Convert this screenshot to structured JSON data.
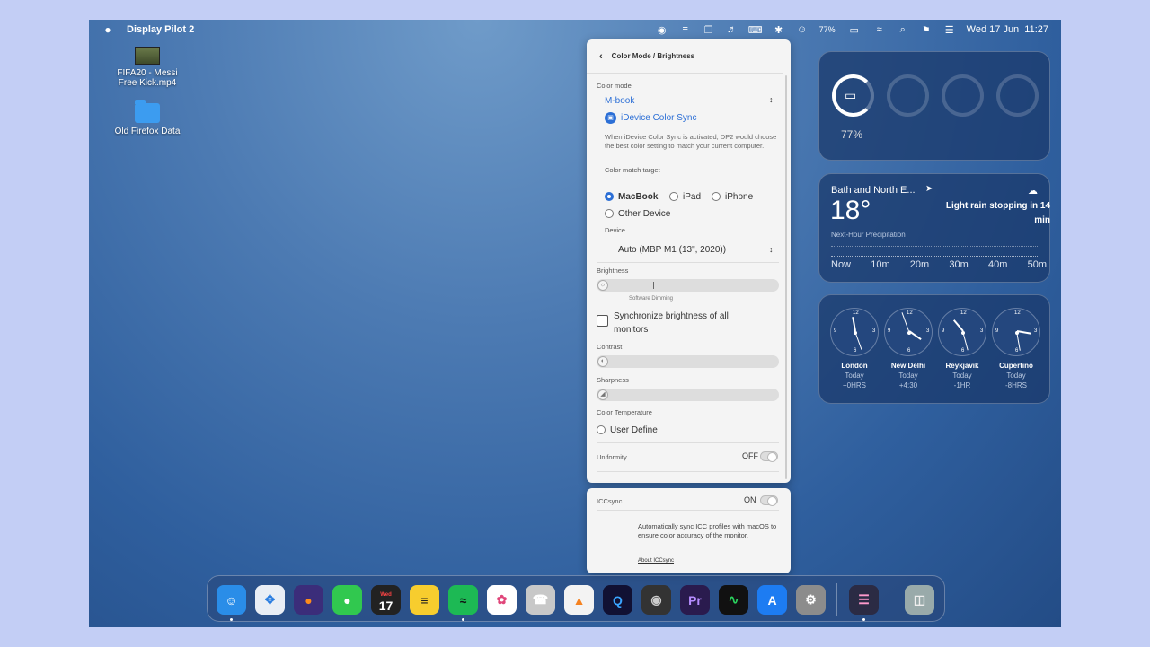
{
  "menubar": {
    "app_name": "Display Pilot 2",
    "battery": "77%",
    "datetime": "Wed 17 Jun  11:27",
    "icons": [
      "display-pilot-icon",
      "menu-extra-icon",
      "window-icon",
      "volume-icon",
      "keyboard-icon",
      "bluetooth-icon",
      "user-icon",
      "battery-icon",
      "wifi-icon",
      "search-icon",
      "flag-icon",
      "control-center-icon"
    ]
  },
  "desktop": {
    "items": [
      {
        "label": "FIFA20 - Messi Free Kick.mp4"
      },
      {
        "label": "Old Firefox Data"
      }
    ]
  },
  "panel": {
    "title": "Color Mode / Brightness",
    "color_mode_label": "Color mode",
    "color_mode_value": "M-book",
    "idevice_sync_label": "iDevice Color Sync",
    "idevice_sync_desc": "When iDevice Color Sync is activated, DP2 would choose the best color setting to match your current computer.",
    "match_target_label": "Color match target",
    "targets": [
      "MacBook",
      "iPad",
      "iPhone",
      "Other Device"
    ],
    "selected_target": "MacBook",
    "device_label": "Device",
    "device_value": "Auto (MBP M1 (13\", 2020))",
    "brightness_label": "Brightness",
    "brightness_note": "Software Dimming",
    "sync_brightness_label": "Synchronize brightness of all monitors",
    "contrast_label": "Contrast",
    "sharpness_label": "Sharpness",
    "color_temp_label": "Color Temperature",
    "user_define_label": "User Define",
    "uniformity_label": "Uniformity",
    "uniformity_state": "OFF"
  },
  "iccsync": {
    "label": "ICCsync",
    "state": "ON",
    "desc": "Automatically sync ICC profiles with macOS to ensure color accuracy of the monitor.",
    "link": "About ICCsync"
  },
  "battery_widget": {
    "percent": "77%",
    "level": 0.77
  },
  "weather_widget": {
    "location": "Bath and North E...",
    "temperature": "18°",
    "forecast": "Light rain stopping in 14 min",
    "precip_label": "Next-Hour Precipitation",
    "times": [
      "Now",
      "10m",
      "20m",
      "30m",
      "40m",
      "50m"
    ]
  },
  "clock_widget": {
    "cities": [
      {
        "name": "London",
        "day": "Today",
        "offset": "+0HRS"
      },
      {
        "name": "New Delhi",
        "day": "Today",
        "offset": "+4:30"
      },
      {
        "name": "Reykjavik",
        "day": "Today",
        "offset": "-1HR"
      },
      {
        "name": "Cupertino",
        "day": "Today",
        "offset": "-8HRS"
      }
    ]
  },
  "dock": {
    "calendar_day": "Wed",
    "calendar_date": "17",
    "apps": [
      "finder",
      "safari",
      "firefox",
      "messages",
      "calendar",
      "notes",
      "spotify",
      "photos",
      "whatsapp",
      "vlc",
      "quicktime",
      "screenshot",
      "premiere",
      "activity-monitor",
      "app-store",
      "system-settings",
      "display-pilot",
      "trash"
    ]
  },
  "colors": {
    "accent": "#2c6fd6",
    "widget_bg": "#1e3e74"
  }
}
